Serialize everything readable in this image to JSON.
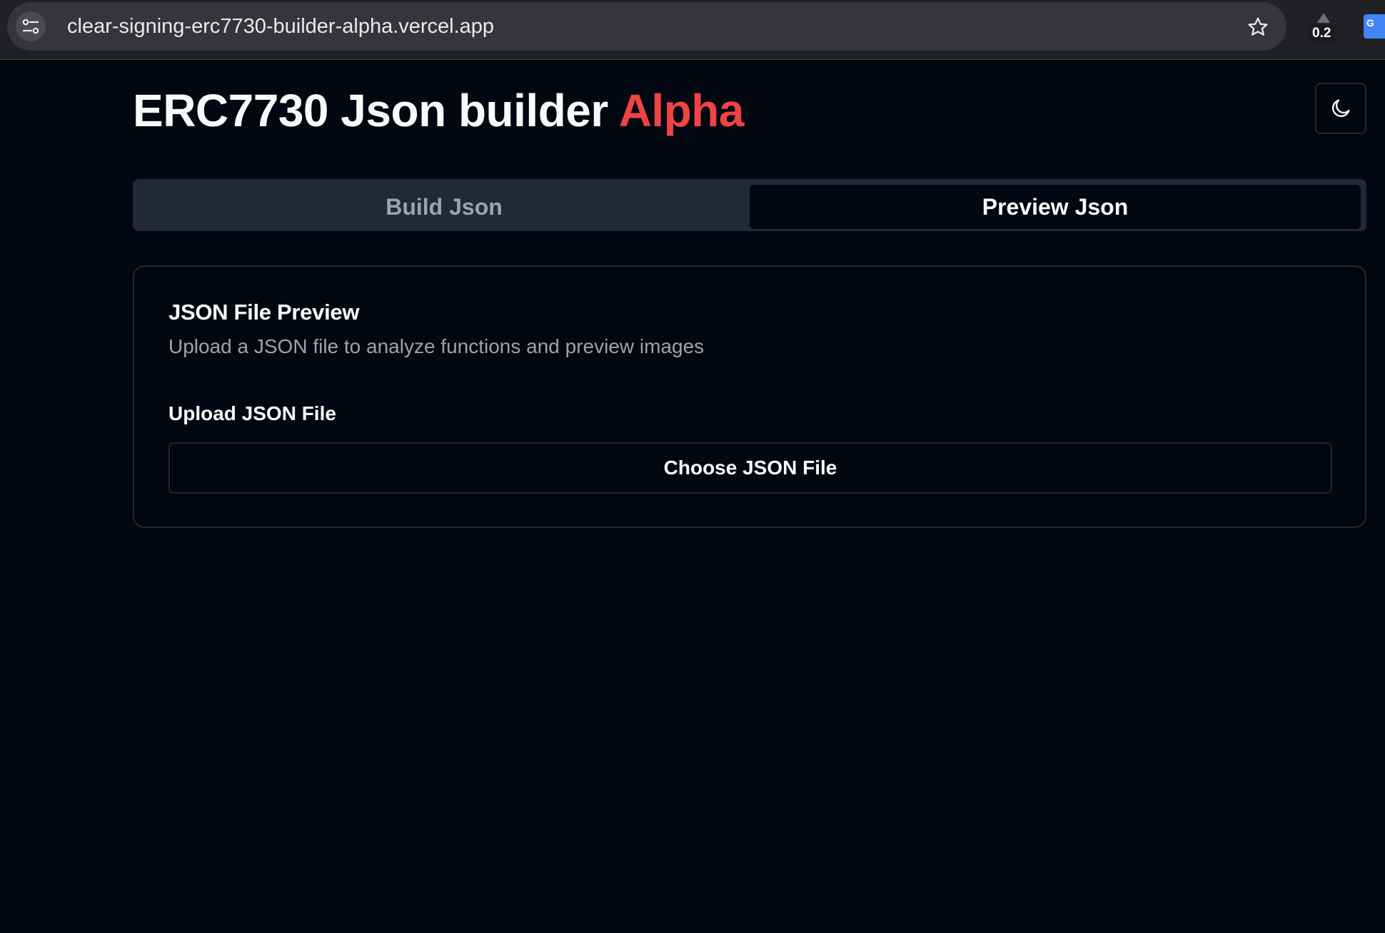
{
  "browser": {
    "url": "clear-signing-erc7730-builder-alpha.vercel.app",
    "extension_badge": "0.2",
    "site_info_icon": "tune-icon",
    "bookmark_icon": "star-icon",
    "translate_icon": "google-translate-icon",
    "translate_glyph": "G"
  },
  "header": {
    "title_main": "ERC7730 Json builder",
    "title_accent": "Alpha",
    "accent_color": "#ef4444",
    "theme_toggle_icon": "moon-icon"
  },
  "tabs": [
    {
      "label": "Build Json",
      "active": false
    },
    {
      "label": "Preview Json",
      "active": true
    }
  ],
  "preview_card": {
    "title": "JSON File Preview",
    "description": "Upload a JSON file to analyze functions and preview images",
    "upload_label": "Upload JSON File",
    "choose_button_label": "Choose JSON File"
  },
  "colors": {
    "background": "#030712",
    "border": "#1f2937",
    "muted_text": "#9ca3af"
  }
}
